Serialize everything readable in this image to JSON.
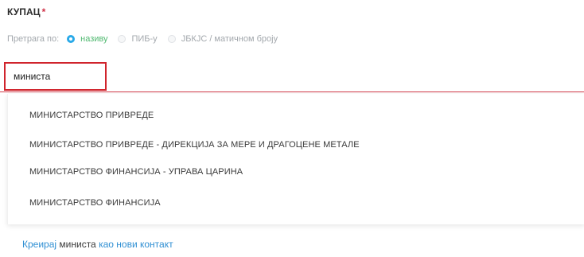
{
  "field": {
    "label": "КУПАЦ",
    "required_mark": "*"
  },
  "search_by": {
    "prefix": "Претрага по:",
    "options": [
      {
        "label": "називу",
        "selected": true
      },
      {
        "label": "ПИБ-у",
        "selected": false
      },
      {
        "label": "ЈБКЈС / матичном броју",
        "selected": false
      }
    ]
  },
  "input": {
    "value": "министа"
  },
  "suggestions": [
    "МИНИСТАРСТВО ПРИВРЕДЕ",
    "МИНИСТАРСТВО ПРИВРЕДЕ - ДИРЕКЦИЈА ЗА МЕРЕ И ДРАГОЦЕНЕ МЕТАЛЕ",
    "МИНИСТАРСТВО ФИНАНСИЈА - УПРАВА ЦАРИНА",
    "МИНИСТАРСТВО ФИНАНСИЈА"
  ],
  "create_contact": {
    "link_prefix": "Креирај",
    "query": "министа",
    "link_suffix": "као нови контакт"
  },
  "colors": {
    "accent_blue": "#29a9e8",
    "selected_text_green": "#50b970",
    "error_red": "#d0242c",
    "link_blue": "#2f8fd3"
  }
}
